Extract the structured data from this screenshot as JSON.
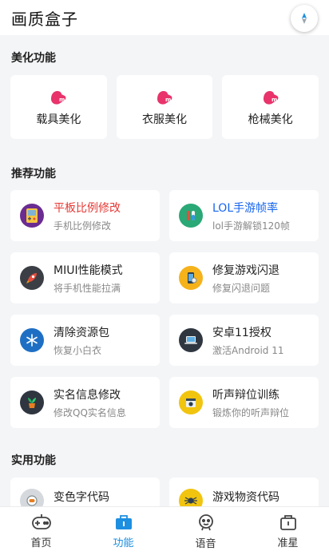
{
  "header": {
    "title": "画质盒子"
  },
  "sections": {
    "beautify": {
      "title": "美化功能",
      "items": [
        {
          "label": "载具美化"
        },
        {
          "label": "衣服美化"
        },
        {
          "label": "枪械美化"
        }
      ]
    },
    "recommend": {
      "title": "推荐功能",
      "items": [
        {
          "title": "平板比例修改",
          "subtitle": "手机比例修改",
          "title_color": "#e53935"
        },
        {
          "title": "LOL手游帧率",
          "subtitle": "lol手游解锁120帧",
          "title_color": "#1565f0"
        },
        {
          "title": "MIUI性能模式",
          "subtitle": "将手机性能拉满",
          "title_color": "#222222"
        },
        {
          "title": "修复游戏闪退",
          "subtitle": "修复闪退问题",
          "title_color": "#222222"
        },
        {
          "title": "清除资源包",
          "subtitle": "恢复小白衣",
          "title_color": "#222222"
        },
        {
          "title": "安卓11授权",
          "subtitle": "激活Android 11",
          "title_color": "#222222"
        },
        {
          "title": "实名信息修改",
          "subtitle": "修改QQ实名信息",
          "title_color": "#222222"
        },
        {
          "title": "听声辩位训练",
          "subtitle": "锻炼你的听声辩位",
          "title_color": "#222222"
        }
      ]
    },
    "utility": {
      "title": "实用功能",
      "items": [
        {
          "title": "变色字代码"
        },
        {
          "title": "游戏物资代码"
        }
      ]
    }
  },
  "bottom_nav": {
    "items": [
      {
        "label": "首页"
      },
      {
        "label": "功能"
      },
      {
        "label": "语音"
      },
      {
        "label": "准星"
      }
    ],
    "active_index": 1
  },
  "colors": {
    "accent": "#1d8fe1",
    "beautify_icon": "#e8336b",
    "recommend_title_red": "#e53935",
    "recommend_title_blue": "#1565f0"
  }
}
